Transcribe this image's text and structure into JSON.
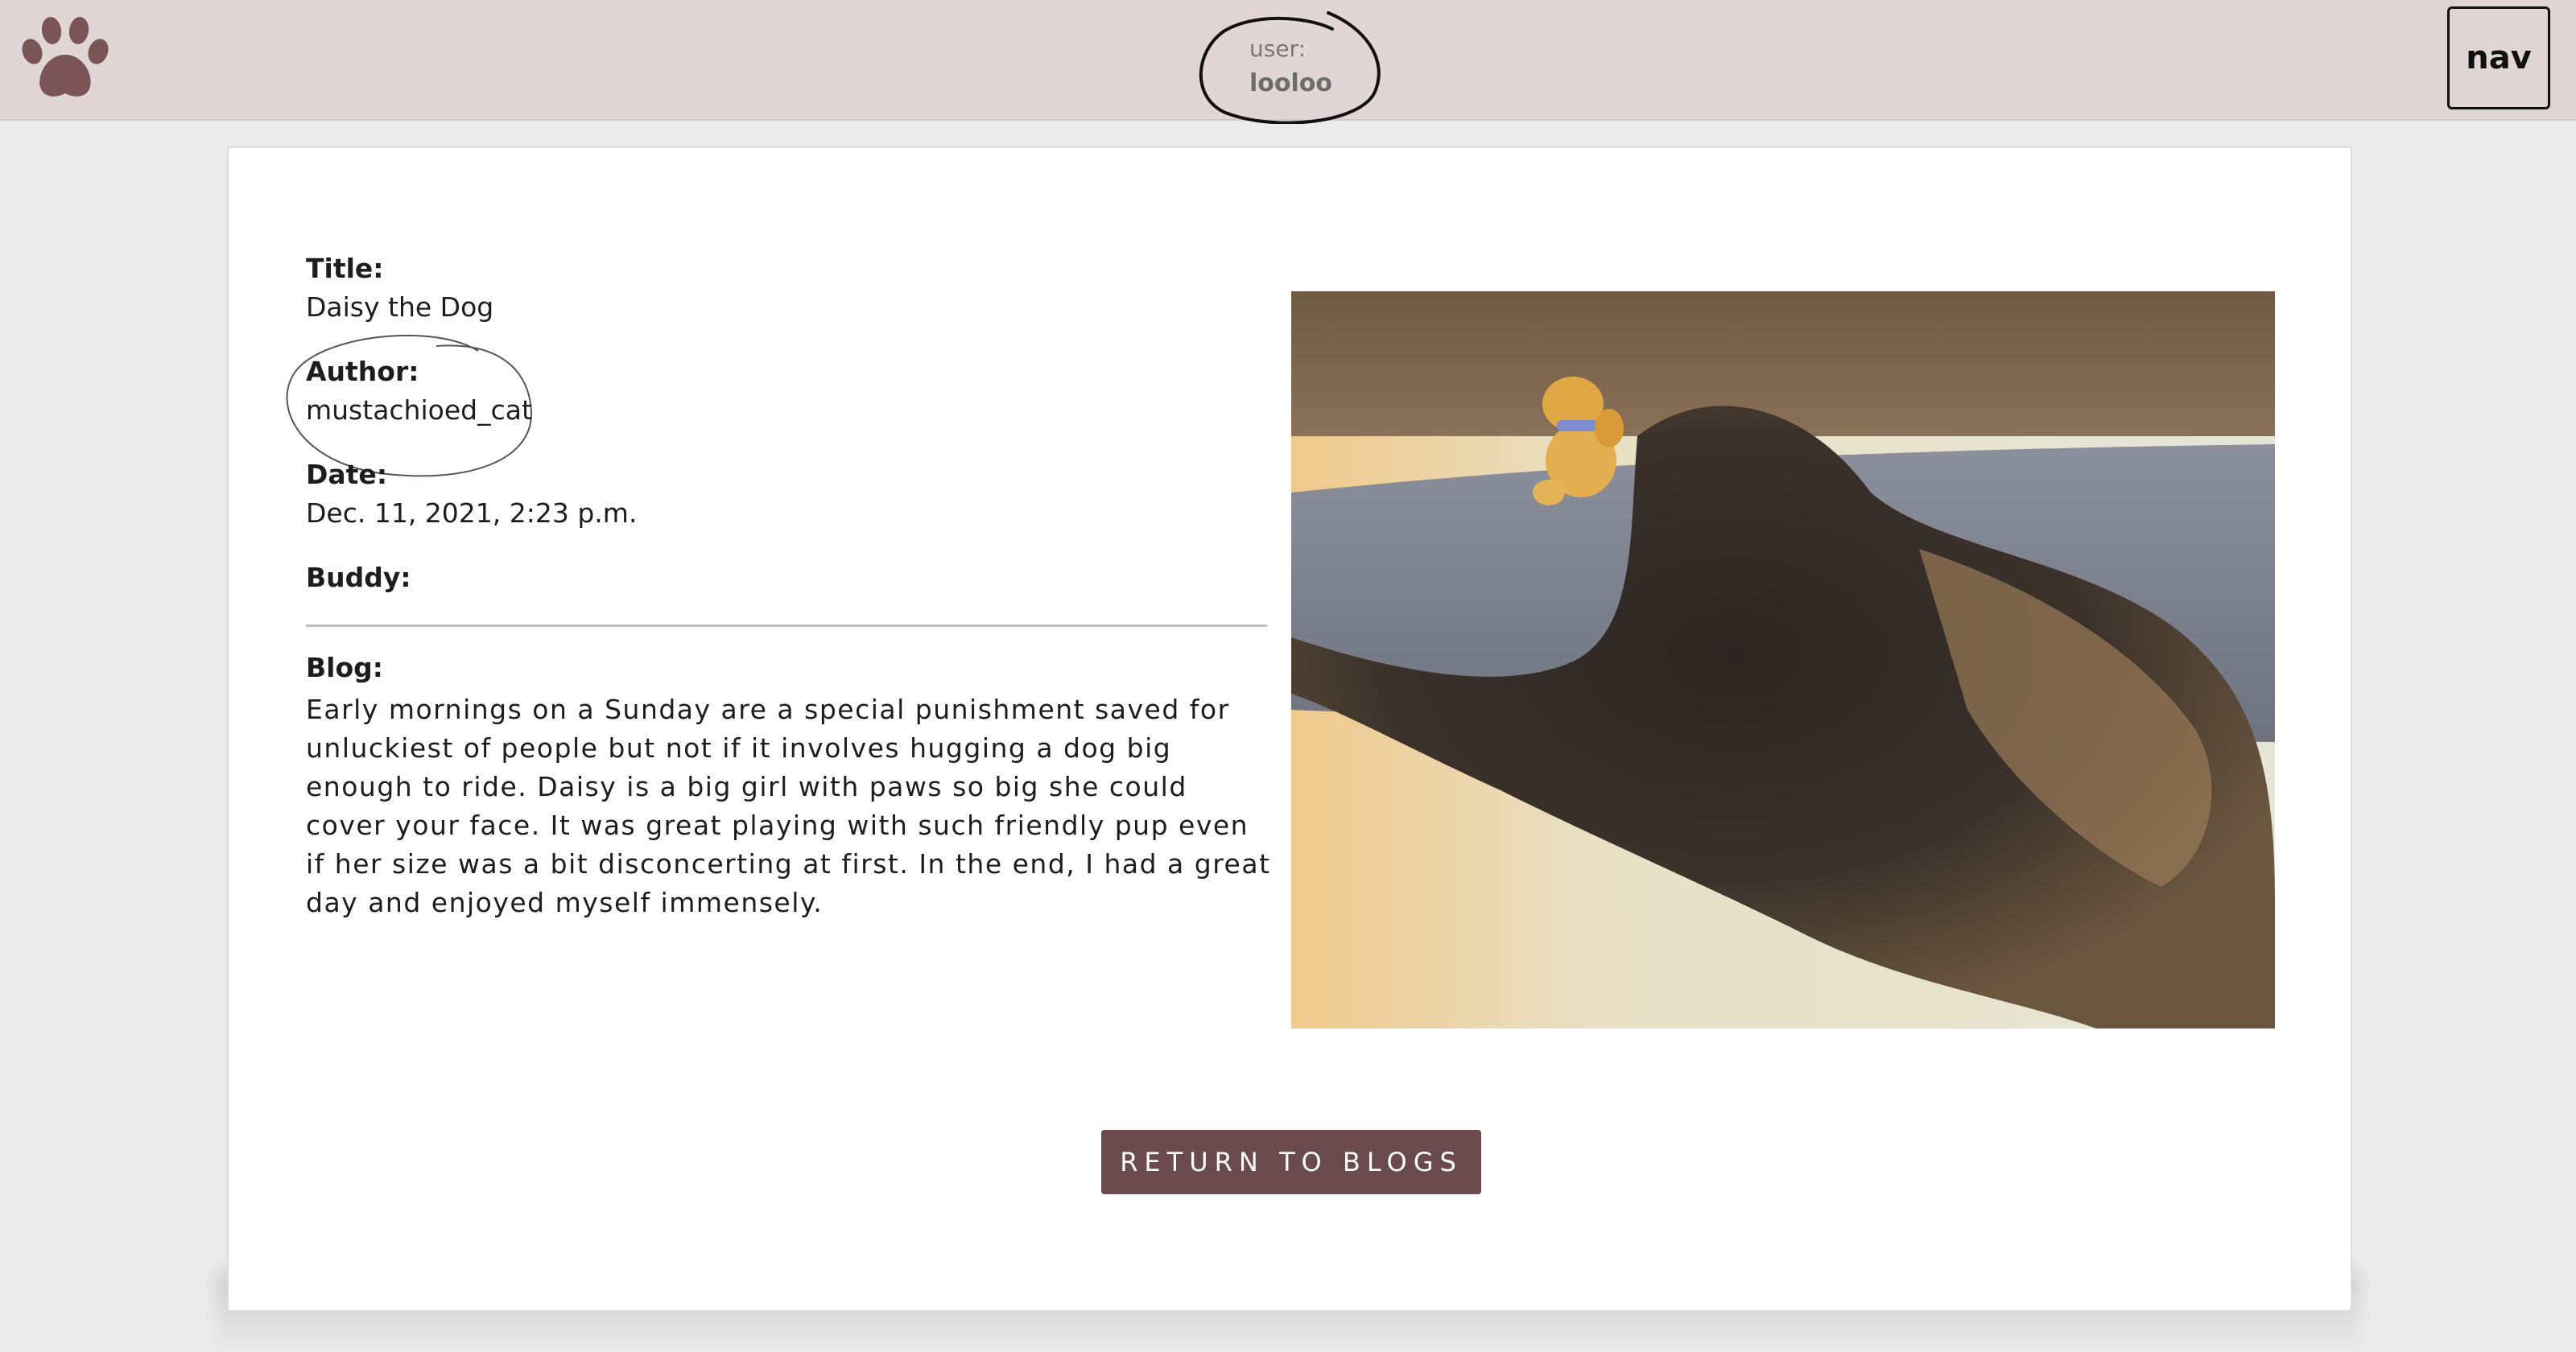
{
  "header": {
    "logo_icon": "paw-icon",
    "user_label": "user:",
    "user_name": "looloo",
    "nav_label": "nav",
    "colors": {
      "header_bg": "#e0d6d6",
      "paw": "#7a5456"
    }
  },
  "post": {
    "title_label": "Title:",
    "title_value": "Daisy the Dog",
    "author_label": "Author:",
    "author_value": "mustachioed_cat",
    "date_label": "Date:",
    "date_value": "Dec. 11, 2021, 2:23 p.m.",
    "buddy_label": "Buddy:",
    "buddy_value": "",
    "blog_label": "Blog:",
    "blog_text": "Early mornings on a Sunday are a special punishment saved for unluckiest of people but not if it involves hugging a dog big enough to ride. Daisy is a big girl with paws so big she could cover your face. It was great playing with such friendly pup even if her size was a bit disconcerting at first. In the end, I had a great day and enjoyed myself immensely."
  },
  "actions": {
    "return_label": "RETURN TO BLOGS",
    "return_color": "#6a4a4d"
  }
}
